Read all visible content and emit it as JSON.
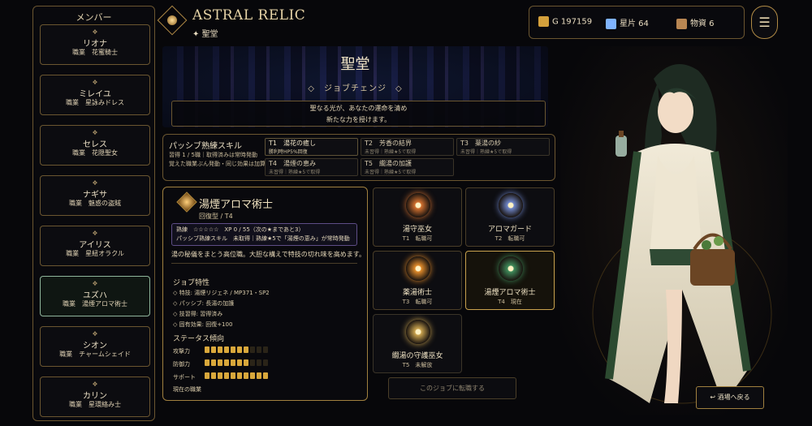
{
  "app": {
    "title": "ASTRAL RELIC",
    "location": "✦ 聖堂"
  },
  "resources": [
    {
      "icon": "gold-coin-icon",
      "label": "G 197159",
      "color": "#d4a03c"
    },
    {
      "icon": "star-shard-icon",
      "label": "星片 64",
      "color": "#7fb3ff"
    },
    {
      "icon": "goods-bag-icon",
      "label": "物資 6",
      "color": "#b88652"
    }
  ],
  "menu_glyph": "☰",
  "sidebar": {
    "title": "メンバー",
    "members": [
      {
        "name": "リオナ",
        "job": "職業　花蜜騎士"
      },
      {
        "name": "ミレイユ",
        "job": "職業　星詠みドレス"
      },
      {
        "name": "セレス",
        "job": "職業　花隠聖女"
      },
      {
        "name": "ナギサ",
        "job": "職業　魅惑の盗賊"
      },
      {
        "name": "アイリス",
        "job": "職業　星紐オラクル"
      },
      {
        "name": "ユズハ",
        "job": "職業　湯煙アロマ術士"
      },
      {
        "name": "シオン",
        "job": "職業　チャームシェイド"
      },
      {
        "name": "カリン",
        "job": "職業　星環絡み士"
      }
    ],
    "member_icon": "❖"
  },
  "banner": {
    "title": "聖堂",
    "subtitle": "◇　ジョブチェンジ　◇",
    "message_lines": [
      "聖なる光が、あなたの運命を清め",
      "新たな力を授けます。"
    ]
  },
  "passive": {
    "title": "パッシブ熟練スキル",
    "lines": [
      "習得 1 / 5職｜取得済みは常時発動",
      "覚えた職業ぶん発動・同じ効果は加算"
    ],
    "skills": [
      {
        "name": "T1　湯花の癒し",
        "desc": "勝利時HP5%回復",
        "on": true
      },
      {
        "name": "T2　芳香の結界",
        "desc": "未習得｜熟練★5で取得",
        "on": false
      },
      {
        "name": "T3　薬湯の紗",
        "desc": "未習得｜熟練★5で取得",
        "on": false
      },
      {
        "name": "T4　湯煙の恵み",
        "desc": "未習得｜熟練★5で取得",
        "on": false
      },
      {
        "name": "T5　繝湯の加護",
        "desc": "未習得｜熟練★5で取得",
        "on": false
      }
    ]
  },
  "detail": {
    "name": "湯煙アロマ術士",
    "type": "回復型 / T4",
    "box_lines": [
      "熟練　☆☆☆☆☆　XP 0 / 55（次の★まであと3）",
      "パッシブ熟練スキル　未取得｜熟練★5で「湯煙の恵み」が常時発動"
    ],
    "description": "湯の秘儀をまとう高位職。大胆な構えで特技の切れ味を高めます。",
    "traits_title": "ジョブ特性",
    "traits": [
      "◇ 特技: 湯煙リジェネ / MP371・SP2",
      "◇ パッシブ: 長湯の加護",
      "◇ 技習得: 習得済み",
      "◇ 固有効果: 回復+100"
    ],
    "stats_title": "ステータス傾向",
    "stats": [
      {
        "label": "攻撃力",
        "value": 7,
        "max": 10
      },
      {
        "label": "防御力",
        "value": 7,
        "max": 10
      },
      {
        "label": "サポート",
        "value": 10,
        "max": 10
      }
    ],
    "current_job_label": "現在の職業"
  },
  "jobs": [
    {
      "name": "湯守巫女",
      "status": "T1　転職可",
      "emblem": "sun-emblem-icon",
      "color": "#d2702f"
    },
    {
      "name": "アロマガード",
      "status": "T2　転職可",
      "emblem": "moon-emblem-icon",
      "color": "#6f86c9"
    },
    {
      "name": "薬湯術士",
      "status": "T3　転職可",
      "emblem": "sun-emblem-icon",
      "color": "#e08a2a"
    },
    {
      "name": "湯煙アロマ術士",
      "status": "T4　現在",
      "emblem": "leaf-emblem-icon",
      "color": "#3f8a5a"
    },
    {
      "name": "繝湯の守護巫女",
      "status": "T5　未解放",
      "emblem": "star-emblem-icon",
      "color": "#c9a24e"
    }
  ],
  "change_button": "このジョブに転職する",
  "back_button": "↩ 酒場へ戻る"
}
